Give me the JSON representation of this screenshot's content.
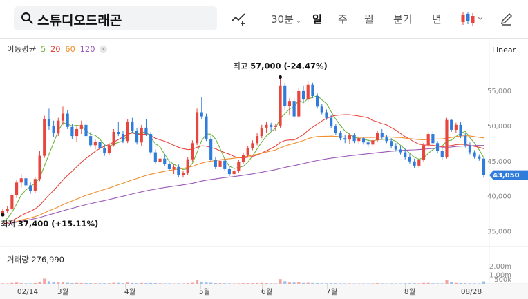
{
  "header": {
    "stock_name": "스튜디오드래곤",
    "intervals": [
      "30분",
      "일",
      "주",
      "월",
      "분기",
      "년"
    ],
    "active_interval": "일",
    "colors": {
      "up": "#e8453c",
      "down": "#2f7cdb",
      "accent": "#111111"
    }
  },
  "chart_data": {
    "type": "candlestick",
    "scale": "Linear",
    "moving_averages": [
      {
        "label": "이동평균",
        "periods": [
          "5",
          "20",
          "60",
          "120"
        ],
        "colors": [
          "#6fb33e",
          "#e8453c",
          "#f08c27",
          "#9b59b6"
        ]
      }
    ],
    "ylim": [
      33000,
      60000
    ],
    "y_ticks": [
      "55,000",
      "50,000",
      "45,000",
      "40,000",
      "35,000"
    ],
    "x_ticks": [
      "02/14",
      "3월",
      "4월",
      "5월",
      "6월",
      "7월",
      "8월",
      "08/28"
    ],
    "current_price": "43,050",
    "high": {
      "label": "최고",
      "value": "57,000",
      "change": "(-24.47%)"
    },
    "low": {
      "label": "최저",
      "value": "37,400",
      "change": "(+15.11%)"
    },
    "volume": {
      "label": "거래량",
      "value": "276,990",
      "ticks": [
        "2.00m",
        "1.00m",
        "500k"
      ]
    },
    "candles": [
      [
        37.5,
        38.2,
        37.4,
        38.0
      ],
      [
        38.0,
        38.6,
        37.7,
        38.3
      ],
      [
        38.3,
        40.5,
        38.0,
        40.2
      ],
      [
        40.2,
        42.4,
        39.8,
        42.0
      ],
      [
        42.0,
        43.2,
        41.3,
        42.6
      ],
      [
        42.6,
        43.0,
        41.3,
        41.6
      ],
      [
        41.6,
        42.0,
        40.4,
        40.8
      ],
      [
        40.8,
        42.8,
        40.5,
        42.5
      ],
      [
        42.5,
        46.5,
        42.2,
        45.8
      ],
      [
        45.8,
        51.5,
        45.5,
        51.0
      ],
      [
        51.0,
        52.5,
        49.5,
        50.0
      ],
      [
        50.0,
        50.8,
        48.5,
        49.0
      ],
      [
        49.0,
        51.2,
        48.6,
        50.8
      ],
      [
        50.8,
        52.8,
        50.2,
        51.8
      ],
      [
        51.8,
        52.3,
        49.6,
        49.9
      ],
      [
        49.9,
        50.3,
        48.2,
        48.6
      ],
      [
        48.6,
        50.0,
        47.8,
        49.6
      ],
      [
        49.6,
        50.8,
        48.9,
        50.2
      ],
      [
        50.2,
        50.6,
        48.2,
        48.6
      ],
      [
        48.6,
        49.2,
        47.0,
        47.3
      ],
      [
        47.3,
        48.2,
        46.7,
        47.8
      ],
      [
        47.8,
        48.6,
        46.6,
        46.9
      ],
      [
        46.9,
        47.4,
        45.8,
        46.2
      ],
      [
        46.2,
        47.6,
        45.9,
        47.3
      ],
      [
        47.3,
        49.6,
        47.1,
        49.2
      ],
      [
        49.2,
        50.6,
        48.6,
        48.9
      ],
      [
        48.9,
        49.4,
        47.6,
        47.9
      ],
      [
        47.9,
        51.0,
        47.6,
        50.6
      ],
      [
        50.6,
        51.2,
        49.0,
        49.3
      ],
      [
        49.3,
        49.8,
        47.4,
        47.7
      ],
      [
        47.7,
        50.2,
        47.2,
        49.8
      ],
      [
        49.8,
        51.0,
        48.6,
        48.9
      ],
      [
        48.9,
        49.2,
        46.0,
        46.3
      ],
      [
        46.3,
        46.7,
        44.6,
        44.9
      ],
      [
        44.9,
        45.8,
        44.2,
        45.4
      ],
      [
        45.4,
        46.1,
        44.3,
        44.6
      ],
      [
        44.6,
        45.0,
        43.6,
        43.9
      ],
      [
        43.9,
        44.6,
        43.2,
        44.2
      ],
      [
        44.2,
        44.6,
        42.8,
        43.1
      ],
      [
        43.1,
        43.7,
        42.7,
        43.4
      ],
      [
        43.4,
        45.6,
        43.1,
        45.3
      ],
      [
        45.3,
        48.0,
        45.0,
        47.6
      ],
      [
        47.6,
        52.5,
        47.3,
        52.0
      ],
      [
        52.0,
        54.2,
        51.0,
        51.4
      ],
      [
        51.4,
        51.8,
        47.9,
        48.2
      ],
      [
        48.2,
        48.6,
        44.9,
        45.2
      ],
      [
        45.2,
        45.6,
        43.9,
        44.2
      ],
      [
        44.2,
        45.5,
        43.8,
        45.1
      ],
      [
        45.1,
        45.4,
        43.6,
        43.9
      ],
      [
        43.9,
        44.2,
        42.9,
        43.2
      ],
      [
        43.2,
        44.0,
        42.9,
        43.6
      ],
      [
        43.6,
        45.2,
        43.4,
        44.9
      ],
      [
        44.9,
        46.2,
        44.6,
        45.9
      ],
      [
        45.9,
        47.2,
        45.6,
        46.9
      ],
      [
        46.9,
        48.0,
        46.6,
        47.6
      ],
      [
        47.6,
        49.0,
        47.3,
        48.6
      ],
      [
        48.6,
        50.2,
        48.3,
        49.8
      ],
      [
        49.8,
        50.6,
        49.0,
        50.2
      ],
      [
        50.2,
        50.5,
        49.4,
        49.9
      ],
      [
        49.9,
        50.4,
        49.3,
        50.1
      ],
      [
        50.1,
        57.0,
        49.8,
        55.8
      ],
      [
        55.8,
        56.2,
        52.4,
        52.9
      ],
      [
        52.9,
        54.0,
        51.6,
        53.6
      ],
      [
        53.6,
        54.2,
        51.0,
        51.4
      ],
      [
        51.4,
        55.4,
        51.2,
        55.0
      ],
      [
        55.0,
        55.8,
        53.4,
        53.8
      ],
      [
        53.8,
        56.4,
        53.5,
        55.9
      ],
      [
        55.9,
        56.2,
        54.0,
        54.3
      ],
      [
        54.3,
        54.8,
        52.5,
        52.8
      ],
      [
        52.8,
        53.2,
        51.7,
        52.0
      ],
      [
        52.0,
        52.4,
        50.9,
        51.2
      ],
      [
        51.2,
        51.6,
        49.7,
        50.0
      ],
      [
        50.0,
        50.3,
        48.8,
        49.1
      ],
      [
        49.1,
        49.4,
        48.0,
        48.3
      ],
      [
        48.3,
        48.8,
        47.6,
        48.1
      ],
      [
        48.1,
        49.0,
        47.5,
        48.7
      ],
      [
        48.7,
        49.1,
        47.6,
        47.9
      ],
      [
        47.9,
        48.6,
        47.4,
        48.3
      ],
      [
        48.3,
        48.5,
        47.4,
        47.7
      ],
      [
        47.7,
        48.1,
        47.0,
        47.4
      ],
      [
        47.4,
        48.2,
        47.1,
        48.0
      ],
      [
        48.0,
        49.4,
        47.8,
        49.1
      ],
      [
        49.1,
        49.6,
        48.1,
        48.4
      ],
      [
        48.4,
        48.8,
        47.6,
        47.9
      ],
      [
        47.9,
        48.3,
        46.9,
        47.2
      ],
      [
        47.2,
        47.6,
        46.4,
        46.7
      ],
      [
        46.7,
        47.2,
        46.0,
        46.3
      ],
      [
        46.3,
        46.8,
        45.3,
        45.6
      ],
      [
        45.6,
        46.1,
        44.7,
        45.0
      ],
      [
        45.0,
        45.4,
        44.0,
        44.4
      ],
      [
        44.4,
        45.5,
        44.1,
        45.2
      ],
      [
        45.2,
        47.6,
        45.0,
        47.3
      ],
      [
        47.3,
        49.2,
        47.0,
        48.9
      ],
      [
        48.9,
        49.3,
        47.3,
        47.6
      ],
      [
        47.6,
        47.9,
        46.2,
        46.5
      ],
      [
        46.5,
        47.0,
        45.2,
        45.6
      ],
      [
        45.6,
        51.2,
        45.4,
        50.9
      ],
      [
        50.9,
        51.0,
        49.2,
        49.5
      ],
      [
        49.5,
        50.5,
        49.1,
        50.2
      ],
      [
        50.2,
        50.6,
        48.3,
        48.6
      ],
      [
        48.6,
        49.0,
        47.0,
        47.3
      ],
      [
        47.3,
        47.7,
        46.0,
        46.3
      ],
      [
        46.3,
        46.6,
        45.4,
        45.7
      ],
      [
        45.7,
        46.0,
        45.1,
        45.4
      ],
      [
        45.4,
        45.5,
        42.7,
        43.05
      ]
    ],
    "volumes": [
      0.05,
      0.04,
      0.1,
      0.14,
      0.07,
      0.05,
      0.05,
      0.08,
      0.25,
      0.6,
      0.3,
      0.18,
      0.15,
      0.2,
      0.12,
      0.08,
      0.1,
      0.09,
      0.08,
      0.07,
      0.06,
      0.06,
      0.07,
      0.06,
      0.12,
      0.1,
      0.07,
      0.15,
      0.09,
      0.07,
      0.1,
      0.08,
      0.09,
      0.08,
      0.06,
      0.05,
      0.05,
      0.04,
      0.05,
      0.04,
      0.07,
      0.12,
      0.45,
      0.25,
      0.15,
      0.12,
      0.08,
      0.07,
      0.06,
      0.05,
      0.04,
      0.05,
      0.07,
      0.08,
      0.07,
      0.09,
      0.1,
      0.08,
      0.06,
      0.05,
      0.55,
      0.3,
      0.15,
      0.14,
      0.2,
      0.1,
      0.12,
      0.09,
      0.07,
      0.06,
      0.06,
      0.07,
      0.06,
      0.05,
      0.05,
      0.05,
      0.04,
      0.04,
      0.04,
      0.04,
      0.05,
      0.07,
      0.05,
      0.04,
      0.05,
      0.05,
      0.04,
      0.06,
      0.06,
      0.07,
      0.05,
      0.1,
      0.1,
      0.06,
      0.05,
      0.05,
      0.45,
      0.2,
      0.1,
      0.08,
      0.07,
      0.06,
      0.05,
      0.05,
      0.28
    ]
  }
}
